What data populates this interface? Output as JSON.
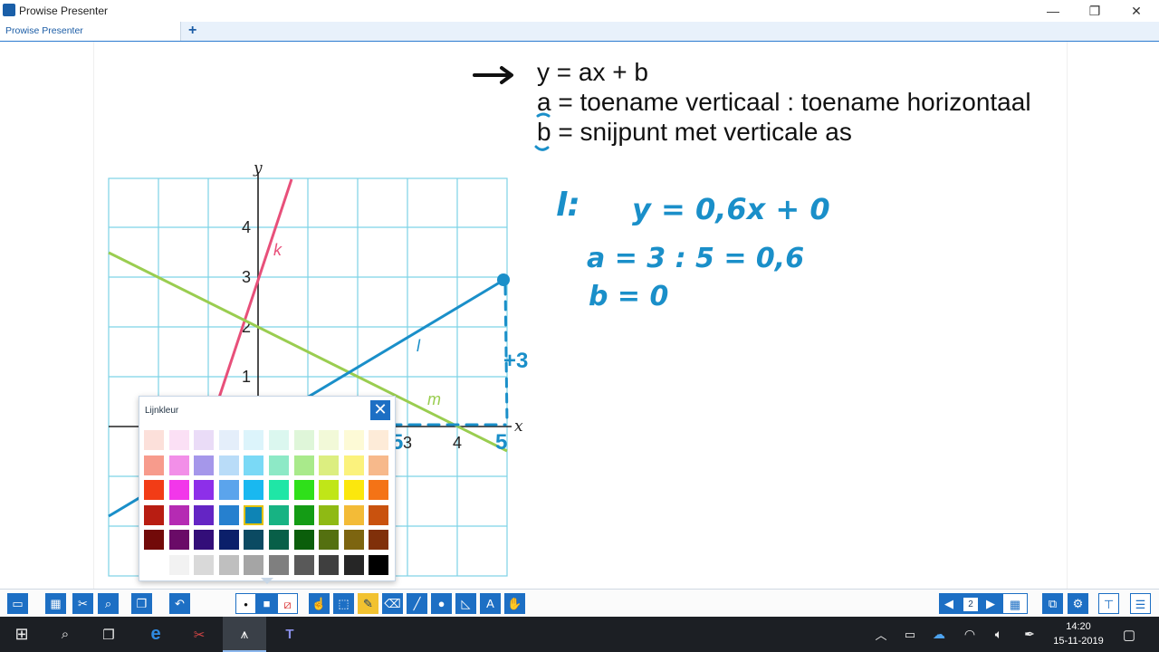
{
  "window": {
    "app_title": "Prowise Presenter",
    "tab_label": "Prowise Presenter",
    "add_tab": "+",
    "minimize": "—",
    "restore": "❐",
    "close": "✕"
  },
  "slide": {
    "formula_lines": [
      "y = ax + b",
      "a = toename verticaal : toename horizontaal",
      "b = snijpunt met verticale as"
    ],
    "graph": {
      "x_label": "x",
      "y_label": "y",
      "x_ticks": [
        "3",
        "4"
      ],
      "y_ticks": [
        "1",
        "2",
        "3",
        "4"
      ],
      "line_labels": [
        "k",
        "l",
        "m"
      ],
      "line_colors": {
        "k": "#e8507a",
        "l": "#1a8fc9",
        "m": "#9acd50"
      },
      "grid_color": "#7dd3e6"
    },
    "handwriting": {
      "line_name": "l:",
      "equation": "y = 0,6x + 0",
      "a_calc": "a = 3 : 5 = 0,6",
      "b_value": "b = 0",
      "rise": "+3",
      "run": "5",
      "ink_color": "#1a8fc9"
    }
  },
  "color_panel": {
    "title": "Lijnkleur",
    "close": "✕",
    "selected": {
      "row": 3,
      "col": 4
    },
    "rows": [
      [
        "#fce0da",
        "#fbe0f5",
        "#eadcf7",
        "#e4eefa",
        "#dcf4fb",
        "#dbf7ef",
        "#dff6d9",
        "#f2f9d8",
        "#fdfad6",
        "#fdebd8"
      ],
      [
        "#f79b8c",
        "#f28fe8",
        "#a597ea",
        "#b9dcf8",
        "#7ad9f6",
        "#8de9c6",
        "#a9ea8b",
        "#dcee80",
        "#fbf27d",
        "#f7b98b"
      ],
      [
        "#f23c16",
        "#f237ea",
        "#8d2fe9",
        "#5ba4ec",
        "#19b8f0",
        "#1fe6a6",
        "#2fe01a",
        "#c0e618",
        "#fbe70d",
        "#f47316"
      ],
      [
        "#b81d12",
        "#b52bb3",
        "#6425c4",
        "#2680cf",
        "#0e84b5",
        "#17b383",
        "#149c15",
        "#8fba14",
        "#f3bb37",
        "#c9520e"
      ],
      [
        "#720a09",
        "#6a0b67",
        "#330e79",
        "#0b1f6a",
        "#0b4a62",
        "#085f48",
        "#0b5e0b",
        "#547010",
        "#7d6510",
        "#80300a"
      ],
      [
        "#ffffff",
        "#f2f2f2",
        "#d9d9d9",
        "#bfbfbf",
        "#a5a5a5",
        "#7f7f7f",
        "#595959",
        "#3f3f3f",
        "#262626",
        "#000000"
      ]
    ]
  },
  "toolbar": {
    "page_number": "2",
    "icons": [
      "folder-icon",
      "images-icon",
      "tools-icon",
      "search-icon",
      "pages-icon",
      "undo-icon",
      "dot-size-small-icon",
      "dot-size-large-icon",
      "no-fill-icon",
      "pointer-icon",
      "select-icon",
      "highlighter-icon",
      "eraser-icon",
      "line-icon",
      "circle-icon",
      "ruler-icon",
      "text-icon",
      "hand-icon",
      "prev-page-icon",
      "next-page-icon",
      "grid-view-icon",
      "network-icon",
      "settings-icon",
      "presentation-icon",
      "menu-icon"
    ]
  },
  "taskbar": {
    "time": "14:20",
    "date": "15-11-2019"
  }
}
